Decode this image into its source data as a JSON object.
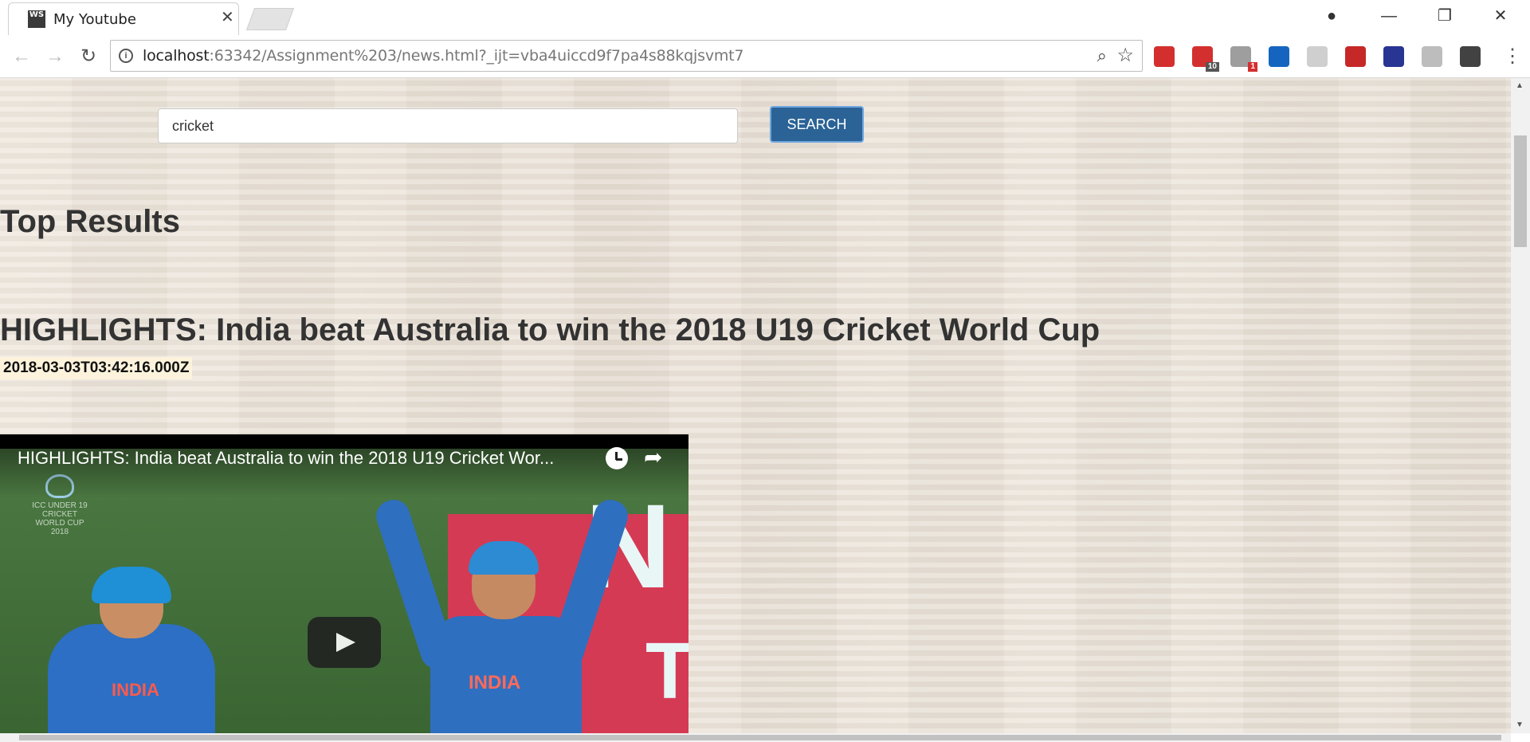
{
  "browser": {
    "tab_title": "My Youtube",
    "tab_favicon_text": "WS",
    "url_host": "localhost",
    "url_rest": ":63342/Assignment%203/news.html?_ijt=vba4uiccd9f7pa4s88kqjsvmt7",
    "extensions": [
      {
        "name": "lastpass-icon",
        "color": "#d32f2f",
        "badge": ""
      },
      {
        "name": "adblock-icon",
        "color": "#d32f2f",
        "badge": "10"
      },
      {
        "name": "shield-extension-icon",
        "color": "#9e9e9e",
        "badge": "1"
      },
      {
        "name": "z-extension-icon",
        "color": "#1565c0",
        "badge": ""
      },
      {
        "name": "leaf-extension-icon",
        "color": "#cfcfcf",
        "badge": ""
      },
      {
        "name": "cors-extension-icon",
        "color": "#c62828",
        "badge": ""
      },
      {
        "name": "flag-extension-icon",
        "color": "#283593",
        "badge": ""
      },
      {
        "name": "hand-extension-icon",
        "color": "#bdbdbd",
        "badge": ""
      },
      {
        "name": "privacy-shield-icon",
        "color": "#424242",
        "badge": ""
      }
    ]
  },
  "search": {
    "value": "cricket",
    "button_label": "SEARCH"
  },
  "results": {
    "heading": "Top Results",
    "items": [
      {
        "title": "HIGHLIGHTS: India beat Australia to win the 2018 U19 Cricket World Cup",
        "published": "2018-03-03T03:42:16.000Z",
        "player_title": "HIGHLIGHTS: India beat Australia to win the 2018 U19 Cricket Wor...",
        "jersey_text": "INDIA",
        "logo_text": "ICC UNDER 19 CRICKET WORLD CUP 2018"
      }
    ]
  }
}
